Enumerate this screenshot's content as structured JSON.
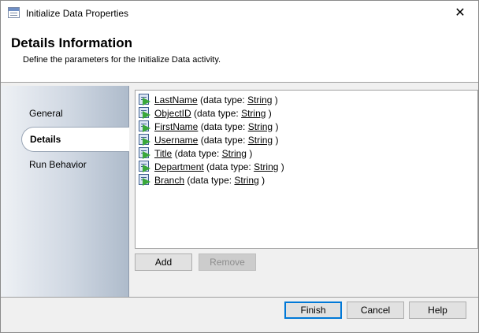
{
  "window": {
    "title": "Initialize Data Properties",
    "close_glyph": "✕"
  },
  "header": {
    "title": "Details Information",
    "subtitle": "Define the parameters for the Initialize Data activity."
  },
  "nav": {
    "items": [
      {
        "label": "General",
        "selected": false
      },
      {
        "label": "Details",
        "selected": true
      },
      {
        "label": "Run Behavior",
        "selected": false
      }
    ]
  },
  "attributes": [
    {
      "name": "LastName",
      "type": "String"
    },
    {
      "name": "ObjectID",
      "type": "String"
    },
    {
      "name": "FirstName",
      "type": "String"
    },
    {
      "name": "Username",
      "type": "String"
    },
    {
      "name": "Title",
      "type": "String"
    },
    {
      "name": "Department",
      "type": "String"
    },
    {
      "name": "Branch",
      "type": "String"
    }
  ],
  "labels": {
    "type_prefix": "(data type:",
    "type_suffix": ")"
  },
  "list_buttons": {
    "add": "Add",
    "remove": "Remove"
  },
  "footer_buttons": {
    "finish": "Finish",
    "cancel": "Cancel",
    "help": "Help"
  },
  "colors": {
    "accent": "#0078d7",
    "arrow_green": "#3aa83a"
  }
}
